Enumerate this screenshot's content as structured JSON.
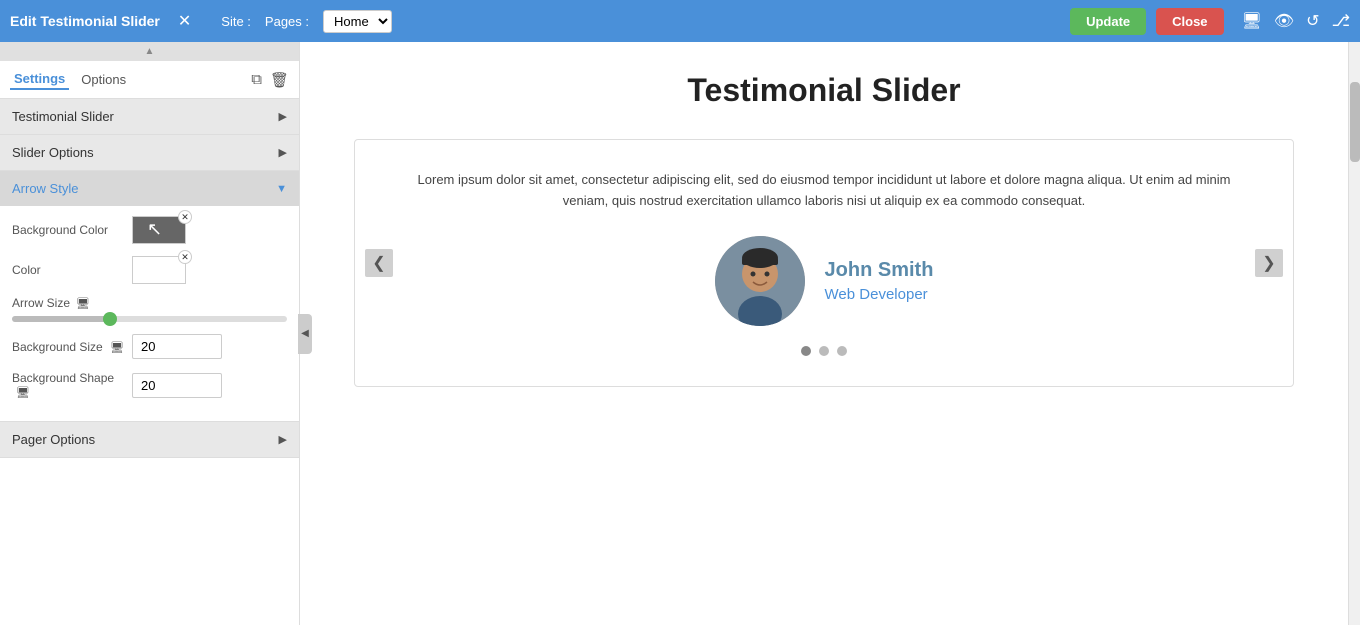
{
  "topbar": {
    "title": "Edit Testimonial Slider",
    "close_label": "✕",
    "site_label": "Site :",
    "pages_label": "Pages :",
    "pages_value": "Home",
    "update_label": "Update",
    "close_btn_label": "Close"
  },
  "left_panel": {
    "tabs": [
      {
        "id": "settings",
        "label": "Settings",
        "active": true
      },
      {
        "id": "options",
        "label": "Options",
        "active": false
      }
    ],
    "copy_icon": "⧉",
    "delete_icon": "🗑",
    "sections": [
      {
        "id": "testimonial-slider",
        "label": "Testimonial Slider",
        "open": false
      },
      {
        "id": "slider-options",
        "label": "Slider Options",
        "open": false
      },
      {
        "id": "arrow-style",
        "label": "Arrow Style",
        "open": true
      },
      {
        "id": "pager-options",
        "label": "Pager Options",
        "open": false
      }
    ],
    "arrow_style": {
      "background_color_label": "Background Color",
      "color_label": "Color",
      "arrow_size_label": "Arrow Size",
      "background_size_label": "Background Size",
      "background_size_value": "20",
      "background_shape_label": "Background Shape",
      "background_shape_value": "20"
    }
  },
  "content": {
    "page_title": "Testimonial Slider",
    "testimonial_text": "Lorem ipsum dolor sit amet, consectetur adipiscing elit, sed do eiusmod tempor incididunt ut labore et dolore magna aliqua. Ut enim ad minim veniam, quis nostrud exercitation ullamco laboris nisi ut aliquip ex ea commodo consequat.",
    "author_name": "John Smith",
    "author_role": "Web Developer",
    "dots": [
      {
        "active": true
      },
      {
        "active": false
      },
      {
        "active": false
      }
    ],
    "prev_arrow": "❮",
    "next_arrow": "❯"
  }
}
